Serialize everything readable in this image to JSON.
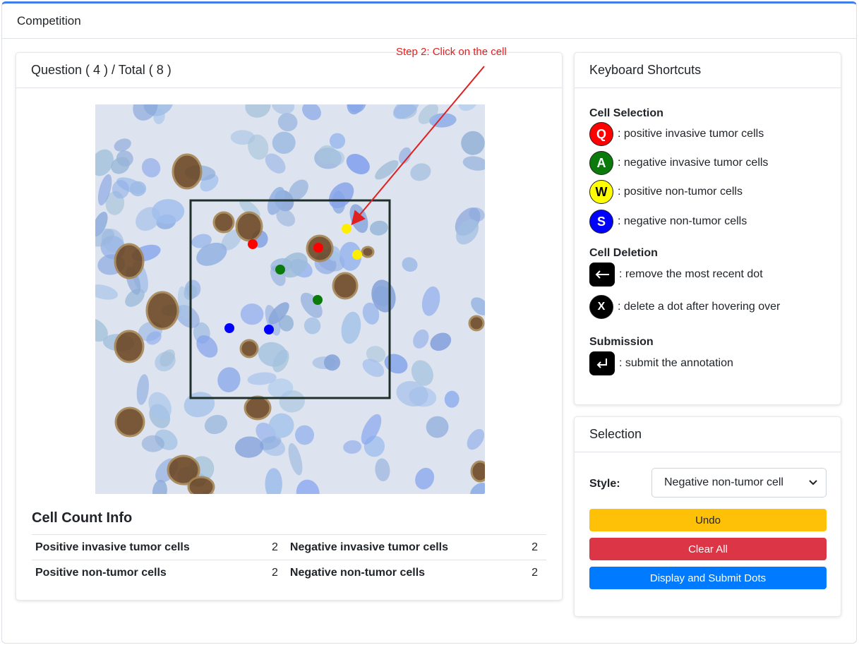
{
  "app": {
    "title": "Competition"
  },
  "question": {
    "header": "Question ( 4 ) / Total ( 8 )",
    "annotation": "Step 2: Click on the cell"
  },
  "dots": [
    {
      "type": "positive-invasive",
      "color": "#ff0000"
    },
    {
      "type": "positive-invasive",
      "color": "#ff0000"
    },
    {
      "type": "negative-invasive",
      "color": "#0a7a0a"
    },
    {
      "type": "negative-invasive",
      "color": "#0a7a0a"
    },
    {
      "type": "positive-non-tumor",
      "color": "#ffee00"
    },
    {
      "type": "positive-non-tumor",
      "color": "#ffee00"
    },
    {
      "type": "negative-non-tumor",
      "color": "#0000ff"
    },
    {
      "type": "negative-non-tumor",
      "color": "#0000ff"
    }
  ],
  "cell_count": {
    "title": "Cell Count Info",
    "rows": [
      {
        "label_a": "Positive invasive tumor cells",
        "value_a": "2",
        "label_b": "Negative invasive tumor cells",
        "value_b": "2"
      },
      {
        "label_a": "Positive non-tumor cells",
        "value_a": "2",
        "label_b": "Negative non-tumor cells",
        "value_b": "2"
      }
    ]
  },
  "shortcuts": {
    "title": "Keyboard Shortcuts",
    "selection_heading": "Cell Selection",
    "selection_items": [
      {
        "key": "Q",
        "text": ": positive invasive tumor cells",
        "bg": "#ff0000",
        "fg": "#ffffff",
        "icon": "q-key-icon"
      },
      {
        "key": "A",
        "text": ": negative invasive tumor cells",
        "bg": "#0a7a0a",
        "fg": "#ffffff",
        "icon": "a-key-icon"
      },
      {
        "key": "W",
        "text": ": positive non-tumor cells",
        "bg": "#ffff00",
        "fg": "#000000",
        "icon": "w-key-icon"
      },
      {
        "key": "S",
        "text": ": negative non-tumor cells",
        "bg": "#0000ff",
        "fg": "#ffffff",
        "icon": "s-key-icon"
      }
    ],
    "deletion_heading": "Cell Deletion",
    "backspace_text": ": remove the most recent dot",
    "x_key": "X",
    "x_text": ": delete a dot after hovering over",
    "submission_heading": "Submission",
    "enter_text": ": submit the annotation"
  },
  "selection": {
    "title": "Selection",
    "style_label": "Style:",
    "style_value": "Negative non-tumor cell",
    "undo_label": "Undo",
    "clear_label": "Clear All",
    "submit_label": "Display and Submit Dots",
    "colors": {
      "undo": "#ffc107",
      "clear": "#dc3545",
      "submit": "#007bff"
    }
  }
}
